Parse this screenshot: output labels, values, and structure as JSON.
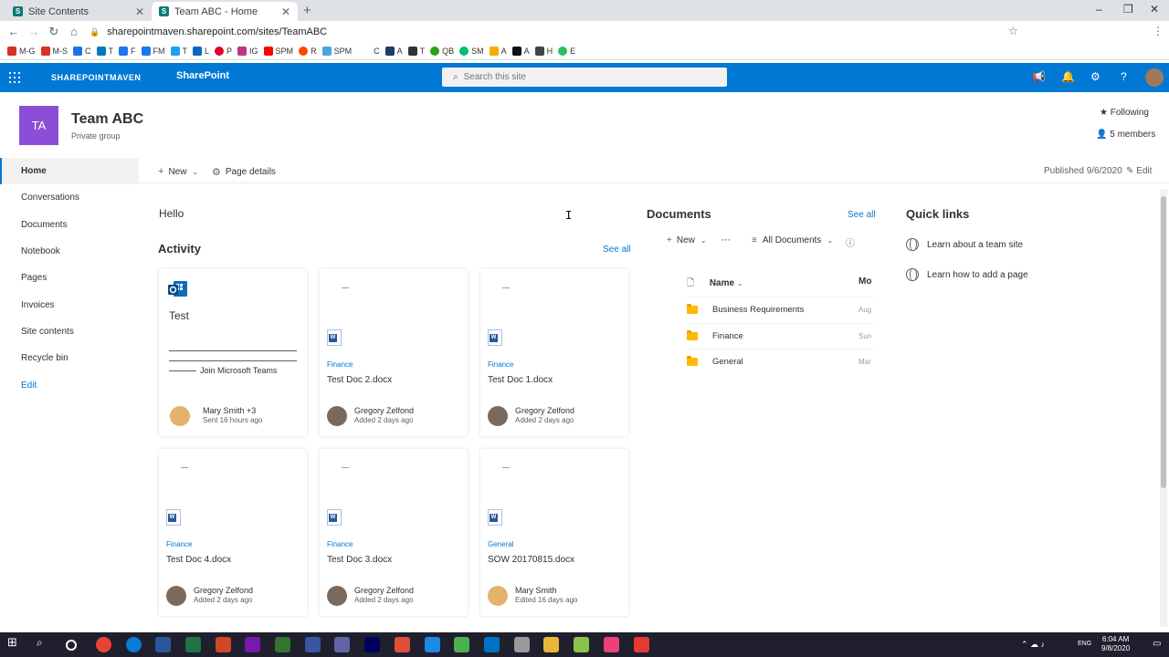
{
  "browser": {
    "tabs": [
      {
        "title": "Site Contents",
        "favicon": "S"
      },
      {
        "title": "Team ABC - Home",
        "favicon": "S"
      }
    ],
    "url": "sharepointmaven.sharepoint.com/sites/TeamABC",
    "bookmarks": [
      "M-G",
      "M-S",
      "C",
      "T",
      "F",
      "FM",
      "T",
      "L",
      "P",
      "IG",
      "SPM",
      "R",
      "SPM",
      "C",
      "A",
      "T",
      "QB",
      "SM",
      "A",
      "A",
      "H",
      "E"
    ]
  },
  "suitebar": {
    "logo_text": "SHAREPOINTMAVEN",
    "brand": "SharePoint",
    "search_placeholder": "Search this site",
    "accent": "#0078d4"
  },
  "site": {
    "logo_initials": "TA",
    "logo_color": "#8d4ed7",
    "title": "Team ABC",
    "subtitle": "Private group",
    "following": "Following",
    "members": "5 members"
  },
  "leftnav": {
    "items": [
      "Home",
      "Conversations",
      "Documents",
      "Notebook",
      "Pages",
      "Invoices",
      "Site contents",
      "Recycle bin"
    ],
    "edit": "Edit"
  },
  "commandbar": {
    "new": "New",
    "page_details": "Page details",
    "published": "Published 9/6/2020",
    "edit": "Edit"
  },
  "main": {
    "hello": "Hello",
    "activity_title": "Activity",
    "see_all": "See all",
    "test_card": {
      "title": "Test",
      "join": "Join Microsoft Teams",
      "person": "Mary Smith +3",
      "meta": "Sent 16 hours ago"
    },
    "cards": [
      {
        "library": "Finance",
        "name": "Test Doc 2.docx",
        "person": "Gregory Zelfond",
        "meta": "Added 2 days ago"
      },
      {
        "library": "Finance",
        "name": "Test Doc 1.docx",
        "person": "Gregory Zelfond",
        "meta": "Added 2 days ago"
      },
      {
        "library": "Finance",
        "name": "Test Doc 4.docx",
        "person": "Gregory Zelfond",
        "meta": "Added 2 days ago"
      },
      {
        "library": "Finance",
        "name": "Test Doc 3.docx",
        "person": "Gregory Zelfond",
        "meta": "Added 2 days ago"
      },
      {
        "library": "General",
        "name": "SOW 20170815.docx",
        "person": "Mary Smith",
        "meta": "Edited 16 days ago"
      }
    ]
  },
  "documents": {
    "title": "Documents",
    "see_all": "See all",
    "new": "New",
    "view": "All Documents",
    "col_name": "Name",
    "col_modified": "Mo",
    "rows": [
      {
        "name": "Business Requirements",
        "modified": "Aug"
      },
      {
        "name": "Finance",
        "modified": "Sun"
      },
      {
        "name": "General",
        "modified": "Mar"
      }
    ]
  },
  "quicklinks": {
    "title": "Quick links",
    "items": [
      "Learn about a team site",
      "Learn how to add a page"
    ]
  },
  "taskbar": {
    "lang": "ENG",
    "time": "6:04 AM",
    "date": "9/8/2020"
  }
}
